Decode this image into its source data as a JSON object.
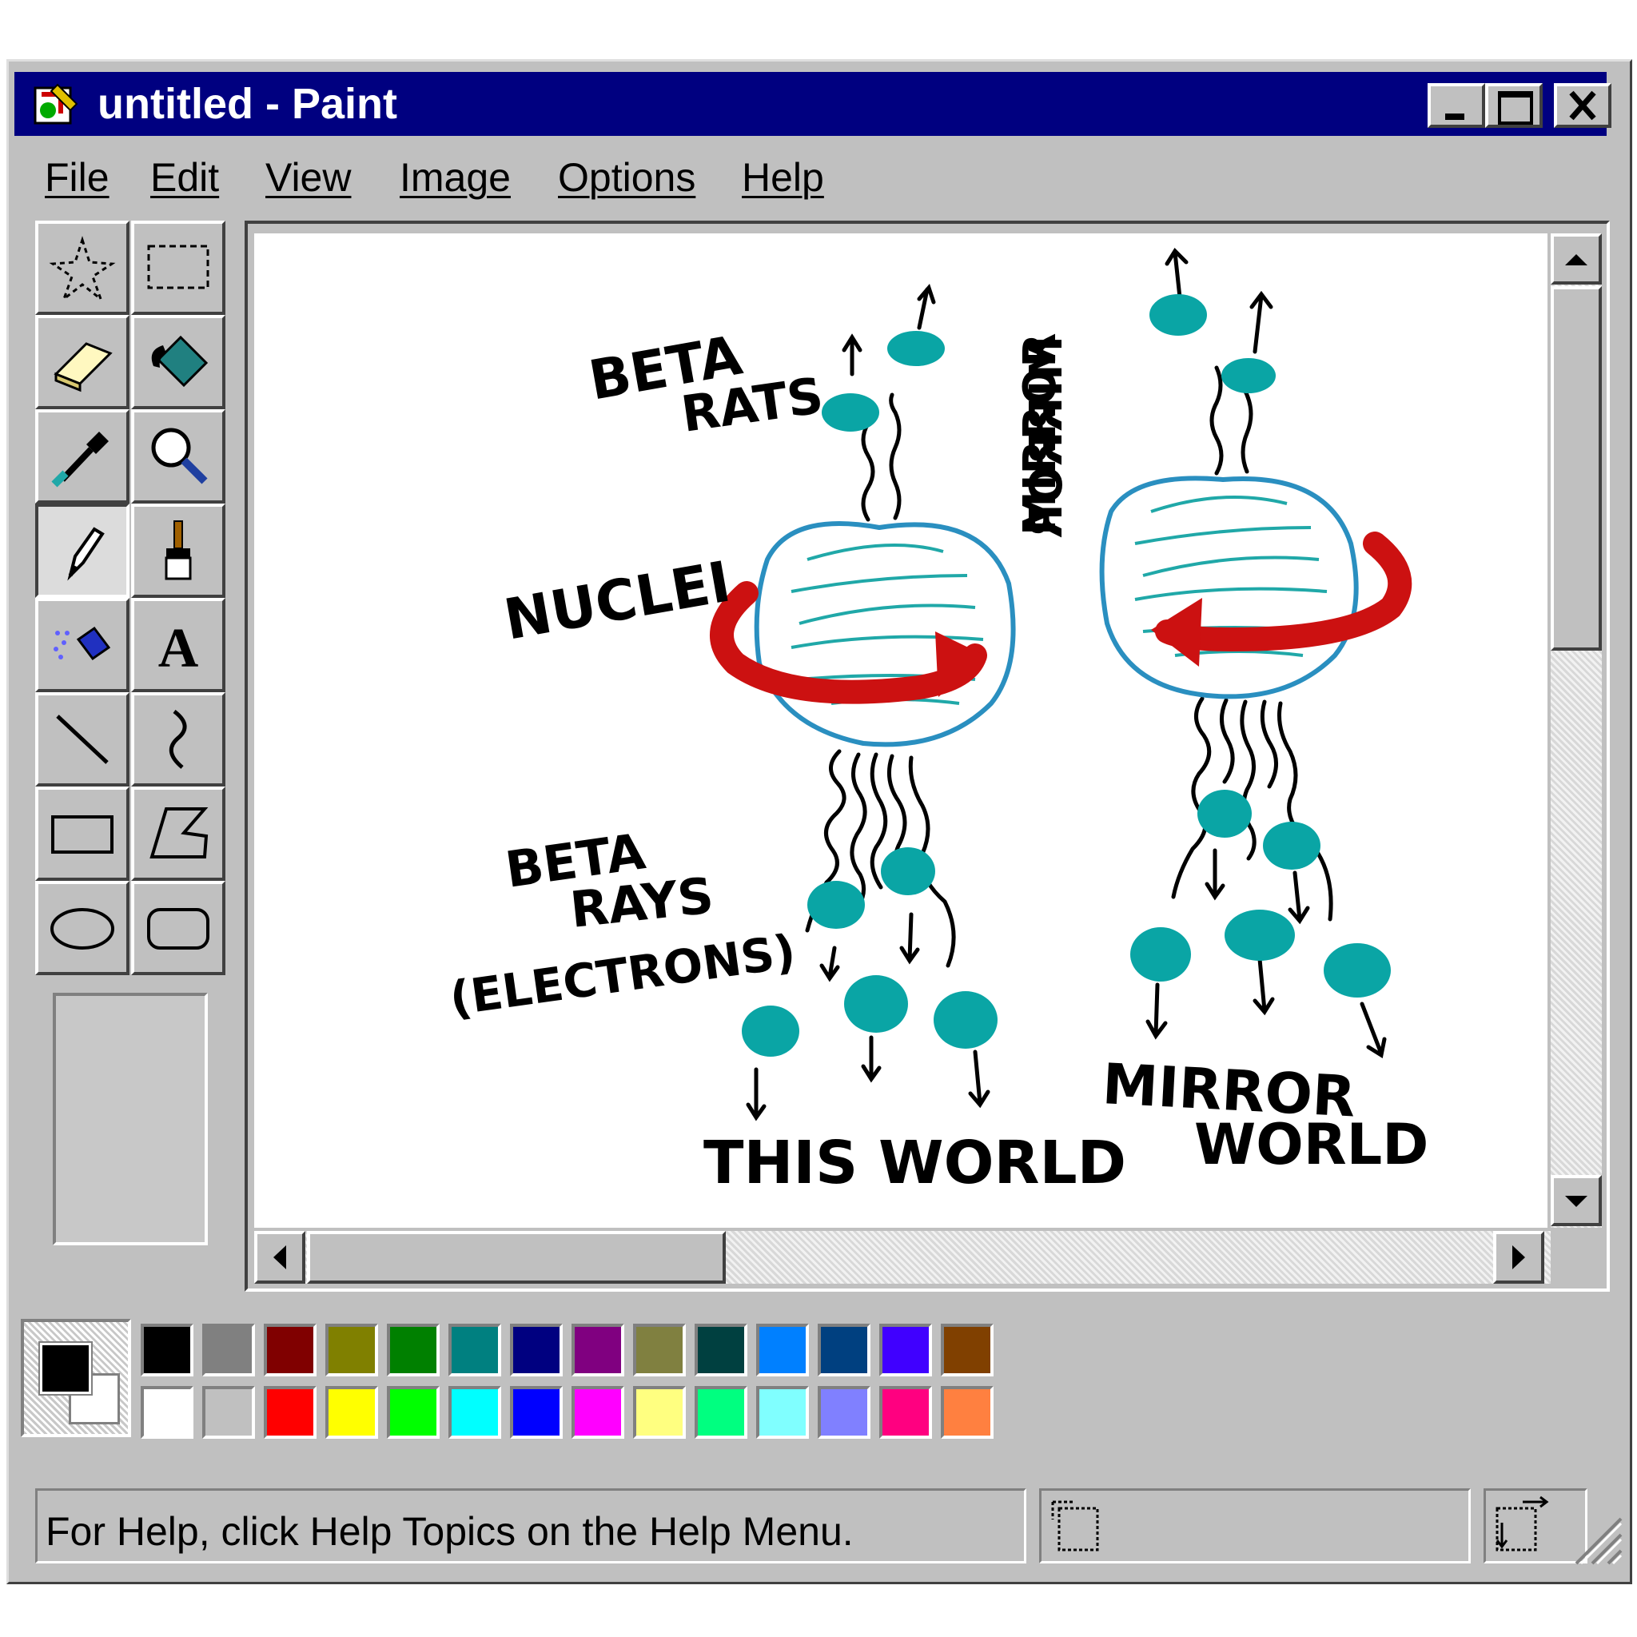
{
  "window": {
    "title": "untitled - Paint",
    "title_color": "#000080"
  },
  "menu": [
    "File",
    "Edit",
    "View",
    "Image",
    "Options",
    "Help"
  ],
  "tools": [
    {
      "name": "free-form-select-icon"
    },
    {
      "name": "select-icon"
    },
    {
      "name": "eraser-icon"
    },
    {
      "name": "fill-with-color-icon"
    },
    {
      "name": "pick-color-icon"
    },
    {
      "name": "magnifier-icon"
    },
    {
      "name": "pencil-icon",
      "active": true
    },
    {
      "name": "brush-icon"
    },
    {
      "name": "airbrush-icon"
    },
    {
      "name": "text-icon",
      "glyph": "A"
    },
    {
      "name": "line-icon"
    },
    {
      "name": "curve-icon"
    },
    {
      "name": "rectangle-icon"
    },
    {
      "name": "polygon-icon"
    },
    {
      "name": "ellipse-icon"
    },
    {
      "name": "rounded-rectangle-icon"
    }
  ],
  "canvas": {
    "labels": {
      "beta_rats": [
        "BETA",
        "RATS"
      ],
      "mirror_mirrored": [
        "MIRROR",
        "MIRROR"
      ],
      "nuclei": "NUCLEI",
      "beta_rays": [
        "BETA",
        "RAYS",
        "(ELECTRONS)"
      ],
      "this_world": "THIS WORLD",
      "mirror_world": [
        "MIRROR",
        "WORLD"
      ]
    },
    "colors": {
      "nucleus_outline": "#2a8fc0",
      "nucleus_lines": "#20a8a8",
      "particle": "#0aa5a5",
      "spin_arrow": "#cc1111"
    }
  },
  "palette": {
    "foreground": "#000000",
    "background": "#ffffff",
    "top_row": [
      "#000000",
      "#808080",
      "#800000",
      "#808000",
      "#008000",
      "#008080",
      "#000080",
      "#800080",
      "#808040",
      "#004040",
      "#0080ff",
      "#004080",
      "#4000ff",
      "#804000"
    ],
    "bottom_row": [
      "#ffffff",
      "#c0c0c0",
      "#ff0000",
      "#ffff00",
      "#00ff00",
      "#00ffff",
      "#0000ff",
      "#ff00ff",
      "#ffff80",
      "#00ff80",
      "#80ffff",
      "#8080ff",
      "#ff0080",
      "#ff8040"
    ]
  },
  "status": {
    "help_text": "For Help, click Help Topics on the Help Menu."
  }
}
